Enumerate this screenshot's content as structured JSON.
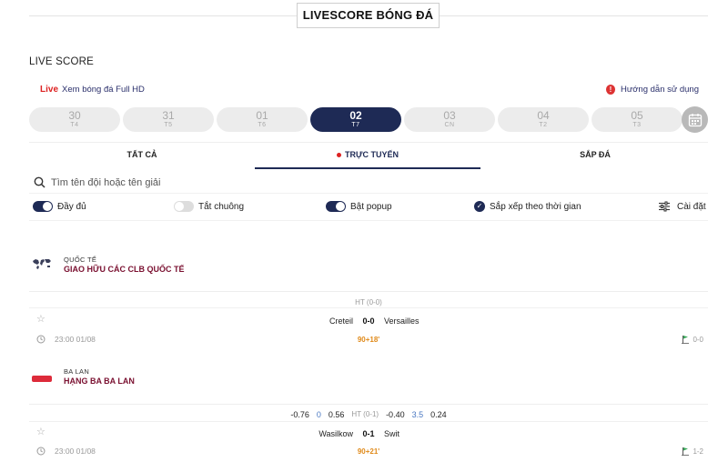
{
  "hero": {
    "title": "LIVESCORE BÓNG ĐÁ"
  },
  "section_title": "LIVE SCORE",
  "live_link": {
    "badge": "Live",
    "text": "Xem bóng đá Full HD"
  },
  "guide_link": {
    "text": "Hướng dẫn sử dụng"
  },
  "dates": [
    {
      "day": "30",
      "weekday": "T4"
    },
    {
      "day": "31",
      "weekday": "T5"
    },
    {
      "day": "01",
      "weekday": "T6"
    },
    {
      "day": "02",
      "weekday": "T7",
      "active": true
    },
    {
      "day": "03",
      "weekday": "CN"
    },
    {
      "day": "04",
      "weekday": "T2"
    },
    {
      "day": "05",
      "weekday": "T3"
    }
  ],
  "tabs": {
    "all": "TẤT CẢ",
    "live": "TRỰC TUYẾN",
    "upcoming": "SẮP ĐÁ"
  },
  "search": {
    "placeholder": "Tìm tên đội hoặc tên giải"
  },
  "options": {
    "full": "Đầy đủ",
    "bell_off": "Tắt chuông",
    "popup": "Bật popup",
    "sort_time": "Sắp xếp theo thời gian",
    "settings": "Cài đặt"
  },
  "leagues": [
    {
      "country": "QUỐC TẾ",
      "name": "GIAO HỮU CÁC CLB QUỐC TẾ",
      "match": {
        "ht": "HT (0-0)",
        "home": "Creteil",
        "score": "0-0",
        "away": "Versailles",
        "time": "23:00 01/08",
        "minute": "90+18'",
        "corners": "0-0"
      }
    },
    {
      "country": "BA LAN",
      "name": "HẠNG BA BA LAN",
      "match": {
        "odds": {
          "h1": "-0.76",
          "h2": "0",
          "h3": "0.56",
          "ht": "HT (0-1)",
          "o1": "-0.40",
          "o2": "3.5",
          "o3": "0.24"
        },
        "home": "Wasilkow",
        "score": "0-1",
        "away": "Swit",
        "time": "23:00 01/08",
        "minute": "90+21'",
        "corners": "1-2"
      }
    }
  ],
  "colors": {
    "navy": "#1e2a55",
    "league_name": "#7a1030",
    "live_red": "#dd2222",
    "minute_orange": "#e08a1a"
  }
}
